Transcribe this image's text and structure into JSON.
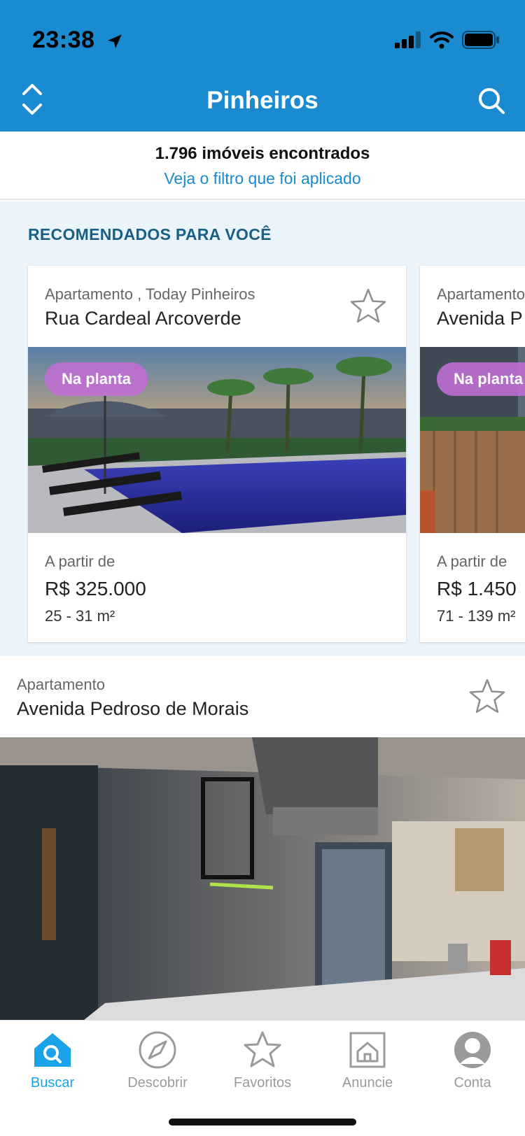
{
  "status": {
    "time": "23:38"
  },
  "header": {
    "title": "Pinheiros"
  },
  "summary": {
    "count": "1.796 imóveis encontrados",
    "filter_link": "Veja o filtro que foi aplicado"
  },
  "recommended": {
    "title": "RECOMENDADOS PARA VOCÊ",
    "cards": [
      {
        "type": "Apartamento , Today Pinheiros",
        "street": "Rua Cardeal Arcoverde",
        "badge": "Na planta",
        "from": "A partir de",
        "price": "R$  325.000",
        "area": "25 - 31 m²"
      },
      {
        "type": "Apartamento",
        "street": "Avenida P",
        "badge": "Na planta",
        "from": "A partir de",
        "price": "R$  1.450",
        "area": "71 - 139 m²"
      }
    ]
  },
  "listing": {
    "type": "Apartamento",
    "street": "Avenida Pedroso de Morais"
  },
  "tabs": [
    {
      "label": "Buscar",
      "icon": "search-home-icon",
      "active": true
    },
    {
      "label": "Descobrir",
      "icon": "compass-icon",
      "active": false
    },
    {
      "label": "Favoritos",
      "icon": "star-icon",
      "active": false
    },
    {
      "label": "Anuncie",
      "icon": "house-icon",
      "active": false
    },
    {
      "label": "Conta",
      "icon": "user-icon",
      "active": false
    }
  ],
  "colors": {
    "header": "#1a8ad1",
    "accent": "#1aa3e8",
    "rec_bg": "#eaf4fa",
    "badge": "#be6ed2"
  }
}
